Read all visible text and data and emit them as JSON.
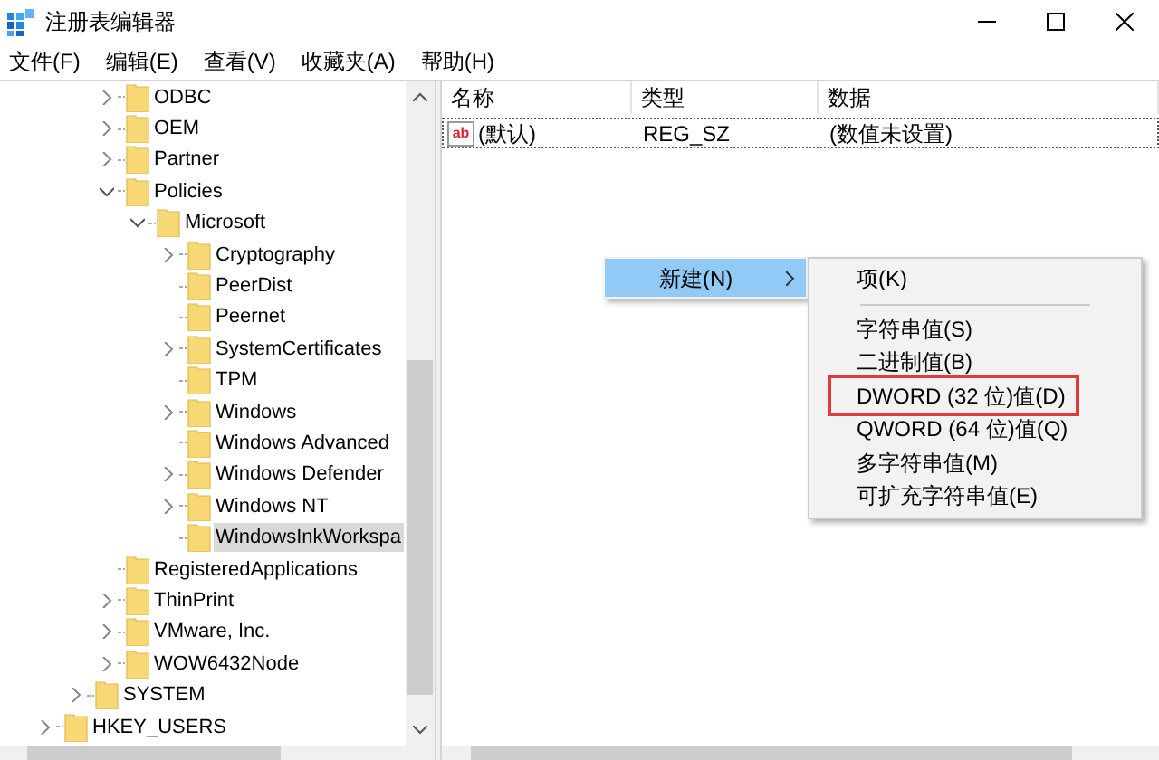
{
  "window": {
    "title": "注册表编辑器"
  },
  "menu_bar": [
    "文件(F)",
    "编辑(E)",
    "查看(V)",
    "收藏夹(A)",
    "帮助(H)"
  ],
  "tree": {
    "items": [
      {
        "children": [
          {
            "children": [
              {
                "label": "ODBC",
                "expanded": false,
                "selected": false
              },
              {
                "label": "OEM",
                "expanded": false,
                "selected": false
              },
              {
                "label": "Partner",
                "expanded": false,
                "selected": false
              },
              {
                "label": "Policies",
                "expanded": true,
                "selected": false,
                "children": [
                  {
                    "label": "Microsoft",
                    "expanded": true,
                    "selected": false,
                    "children": [
                      {
                        "label": "Cryptography",
                        "expanded": false,
                        "selected": false
                      },
                      {
                        "label": "PeerDist",
                        "selected": false
                      },
                      {
                        "label": "Peernet",
                        "selected": false
                      },
                      {
                        "label": "SystemCertificates",
                        "expanded": false,
                        "selected": false
                      },
                      {
                        "label": "TPM",
                        "selected": false
                      },
                      {
                        "label": "Windows",
                        "expanded": false,
                        "selected": false
                      },
                      {
                        "label": "Windows Advanced",
                        "selected": false
                      },
                      {
                        "label": "Windows Defender",
                        "expanded": false,
                        "selected": false
                      },
                      {
                        "label": "Windows NT",
                        "expanded": false,
                        "selected": false
                      },
                      {
                        "label": "WindowsInkWorkspa",
                        "selected": true
                      }
                    ]
                  }
                ]
              },
              {
                "label": "RegisteredApplications",
                "selected": false
              },
              {
                "label": "ThinPrint",
                "expanded": false,
                "selected": false
              },
              {
                "label": "VMware, Inc.",
                "expanded": false,
                "selected": false
              },
              {
                "label": "WOW6432Node",
                "expanded": false,
                "selected": false
              }
            ]
          },
          {
            "label": "SYSTEM",
            "expanded": false,
            "selected": false
          }
        ]
      },
      {
        "label": "HKEY_USERS",
        "expanded": false,
        "selected": false
      }
    ]
  },
  "values": {
    "columns": [
      "名称",
      "类型",
      "数据"
    ],
    "rows": [
      {
        "icon_label": "ab",
        "name": "(默认)",
        "type": "REG_SZ",
        "data": "(数值未设置)",
        "focused": true
      }
    ]
  },
  "context_menu": {
    "items": [
      {
        "label": "新建(N)",
        "selected": true,
        "submenu": true
      }
    ]
  },
  "submenu": {
    "items": [
      {
        "kind": "item",
        "label": "项(K)",
        "annotated": false
      },
      {
        "kind": "separator"
      },
      {
        "kind": "item",
        "label": "字符串值(S)",
        "annotated": false
      },
      {
        "kind": "item",
        "label": "二进制值(B)",
        "annotated": false
      },
      {
        "kind": "item",
        "label": "DWORD (32 位)值(D)",
        "annotated": true
      },
      {
        "kind": "item",
        "label": "QWORD (64 位)值(Q)",
        "annotated": false
      },
      {
        "kind": "item",
        "label": "多字符串值(M)",
        "annotated": false
      },
      {
        "kind": "item",
        "label": "可扩充字符串值(E)",
        "annotated": false
      }
    ]
  }
}
